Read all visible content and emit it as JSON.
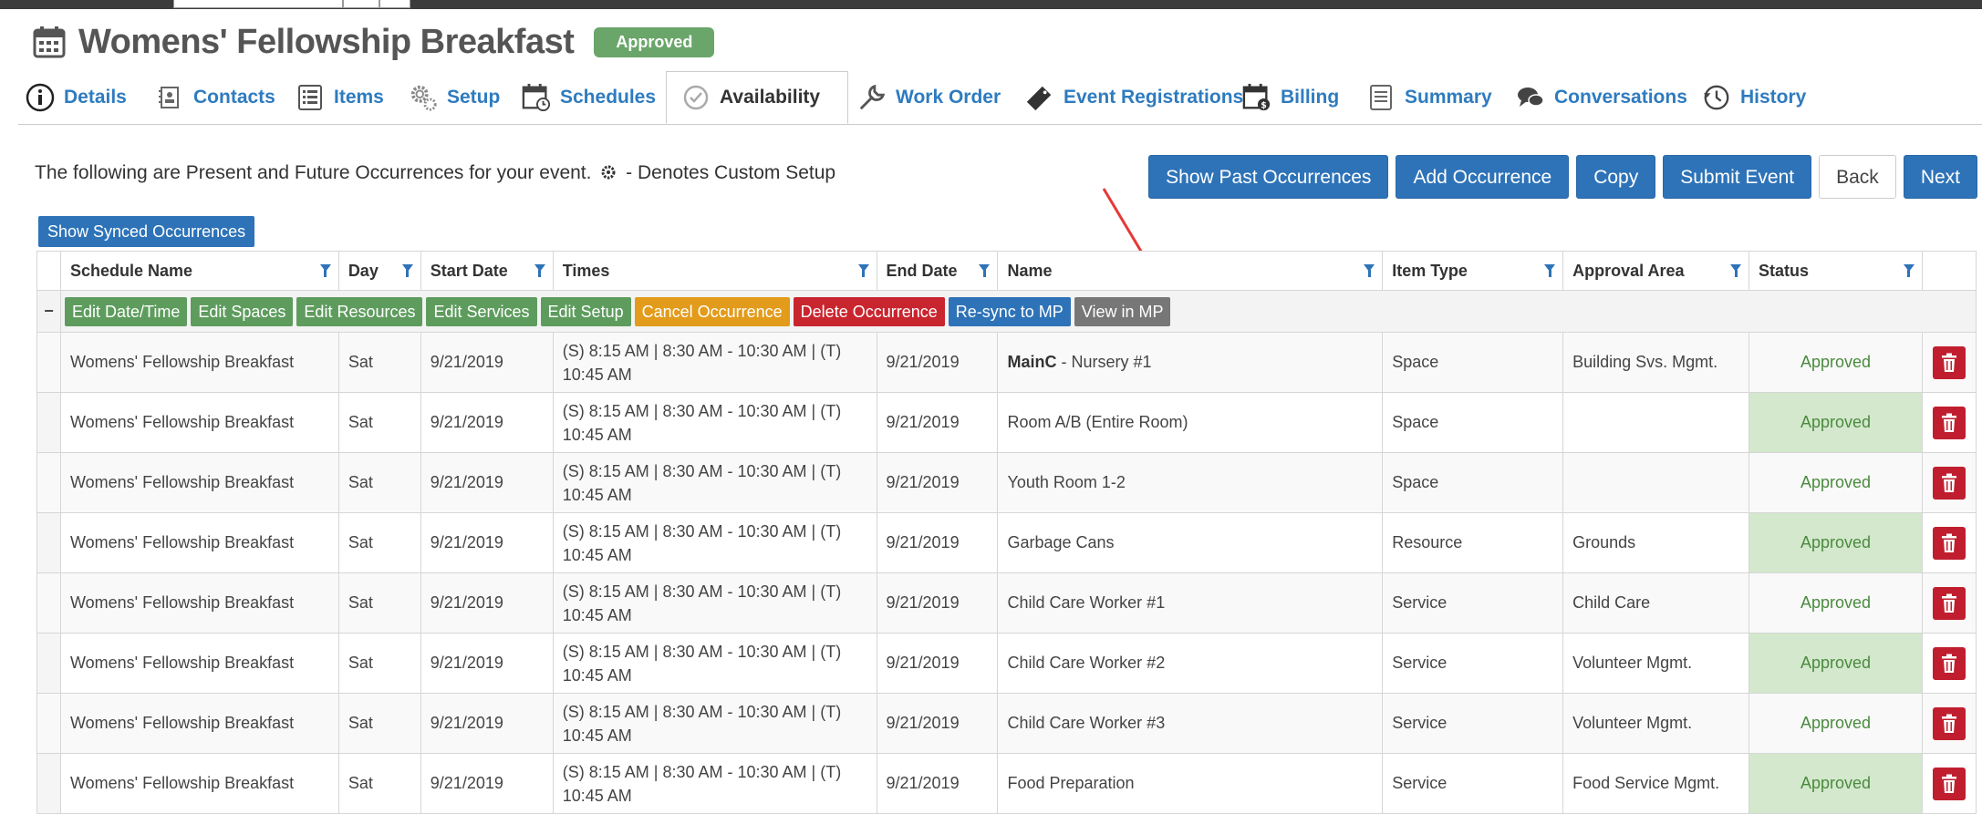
{
  "event": {
    "title": "Womens' Fellowship Breakfast",
    "status": "Approved"
  },
  "tabs": [
    {
      "label": "Details",
      "icon": "info-icon"
    },
    {
      "label": "Contacts",
      "icon": "contacts-icon"
    },
    {
      "label": "Items",
      "icon": "list-icon"
    },
    {
      "label": "Setup",
      "icon": "gears-icon"
    },
    {
      "label": "Schedules",
      "icon": "calendar-clock-icon"
    },
    {
      "label": "Availability",
      "icon": "check-circle-icon"
    },
    {
      "label": "Work Order",
      "icon": "wrench-icon"
    },
    {
      "label": "Event Registrations",
      "icon": "ticket-icon"
    },
    {
      "label": "Billing",
      "icon": "calendar-dollar-icon"
    },
    {
      "label": "Summary",
      "icon": "document-icon"
    },
    {
      "label": "Conversations",
      "icon": "chat-icon"
    },
    {
      "label": "History",
      "icon": "history-icon"
    }
  ],
  "intro": {
    "text_before": "The following are Present and Future Occurrences for your event.",
    "text_after": "- Denotes Custom Setup"
  },
  "buttons": {
    "show_past": "Show Past Occurrences",
    "add": "Add Occurrence",
    "copy": "Copy",
    "submit": "Submit Event",
    "back": "Back",
    "next": "Next",
    "show_synced": "Show Synced Occurrences"
  },
  "columns": [
    "Schedule Name",
    "Day",
    "Start Date",
    "Times",
    "End Date",
    "Name",
    "Item Type",
    "Approval Area",
    "Status"
  ],
  "actions": {
    "collapse": "−",
    "edit_datetime": "Edit Date/Time",
    "edit_spaces": "Edit Spaces",
    "edit_resources": "Edit Resources",
    "edit_services": "Edit Services",
    "edit_setup": "Edit Setup",
    "cancel_occurrence": "Cancel Occurrence",
    "delete_occurrence": "Delete Occurrence",
    "resync": "Re-sync to MP",
    "view_mp": "View in MP"
  },
  "rows": [
    {
      "schedule": "Womens' Fellowship Breakfast",
      "day": "Sat",
      "start": "9/21/2019",
      "times1": "(S) 8:15 AM | 8:30 AM - 10:30 AM | (T)",
      "times2": "10:45 AM",
      "end": "9/21/2019",
      "name_prefix": "MainC",
      "name": " - Nursery #1",
      "type": "Space",
      "area": "Building Svs. Mgmt.",
      "status": "Approved"
    },
    {
      "schedule": "Womens' Fellowship Breakfast",
      "day": "Sat",
      "start": "9/21/2019",
      "times1": "(S) 8:15 AM | 8:30 AM - 10:30 AM | (T)",
      "times2": "10:45 AM",
      "end": "9/21/2019",
      "name_prefix": "",
      "name": "Room A/B (Entire Room)",
      "type": "Space",
      "area": "",
      "status": "Approved"
    },
    {
      "schedule": "Womens' Fellowship Breakfast",
      "day": "Sat",
      "start": "9/21/2019",
      "times1": "(S) 8:15 AM | 8:30 AM - 10:30 AM | (T)",
      "times2": "10:45 AM",
      "end": "9/21/2019",
      "name_prefix": "",
      "name": "Youth Room 1-2",
      "type": "Space",
      "area": "",
      "status": "Approved"
    },
    {
      "schedule": "Womens' Fellowship Breakfast",
      "day": "Sat",
      "start": "9/21/2019",
      "times1": "(S) 8:15 AM | 8:30 AM - 10:30 AM | (T)",
      "times2": "10:45 AM",
      "end": "9/21/2019",
      "name_prefix": "",
      "name": "Garbage Cans",
      "type": "Resource",
      "area": "Grounds",
      "status": "Approved"
    },
    {
      "schedule": "Womens' Fellowship Breakfast",
      "day": "Sat",
      "start": "9/21/2019",
      "times1": "(S) 8:15 AM | 8:30 AM - 10:30 AM | (T)",
      "times2": "10:45 AM",
      "end": "9/21/2019",
      "name_prefix": "",
      "name": "Child Care Worker #1",
      "type": "Service",
      "area": "Child Care",
      "status": "Approved"
    },
    {
      "schedule": "Womens' Fellowship Breakfast",
      "day": "Sat",
      "start": "9/21/2019",
      "times1": "(S) 8:15 AM | 8:30 AM - 10:30 AM | (T)",
      "times2": "10:45 AM",
      "end": "9/21/2019",
      "name_prefix": "",
      "name": "Child Care Worker #2",
      "type": "Service",
      "area": "Volunteer Mgmt.",
      "status": "Approved"
    },
    {
      "schedule": "Womens' Fellowship Breakfast",
      "day": "Sat",
      "start": "9/21/2019",
      "times1": "(S) 8:15 AM | 8:30 AM - 10:30 AM | (T)",
      "times2": "10:45 AM",
      "end": "9/21/2019",
      "name_prefix": "",
      "name": "Child Care Worker #3",
      "type": "Service",
      "area": "Volunteer Mgmt.",
      "status": "Approved"
    },
    {
      "schedule": "Womens' Fellowship Breakfast",
      "day": "Sat",
      "start": "9/21/2019",
      "times1": "(S) 8:15 AM | 8:30 AM - 10:30 AM | (T)",
      "times2": "10:45 AM",
      "end": "9/21/2019",
      "name_prefix": "",
      "name": "Food Preparation",
      "type": "Service",
      "area": "Food Service Mgmt.",
      "status": "Approved"
    }
  ],
  "colors": {
    "link": "#2e7bbf",
    "primary": "#2e73b8",
    "approved_bg": "#d3e8cc",
    "approved_text": "#4a8a3e",
    "danger": "#c01e2e",
    "warning": "#e29b1b",
    "success": "#5e9c5e",
    "annotation_arrow": "#e53935"
  }
}
